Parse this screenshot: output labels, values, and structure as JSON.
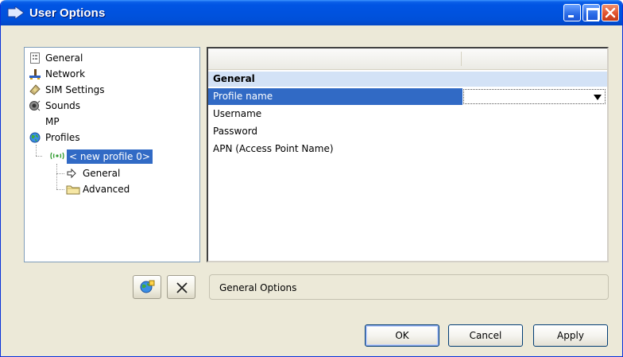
{
  "window": {
    "title": "User Options"
  },
  "tree": {
    "items": [
      {
        "label": "General",
        "icon": "document-list-icon"
      },
      {
        "label": "Network",
        "icon": "network-icon"
      },
      {
        "label": "SIM Settings",
        "icon": "sim-card-icon"
      },
      {
        "label": "Sounds",
        "icon": "speaker-icon"
      },
      {
        "label": "MP",
        "icon": ""
      },
      {
        "label": "Profiles",
        "icon": "globe-icon"
      }
    ],
    "profile": {
      "label": "< new profile 0>",
      "icon": "antenna-icon"
    },
    "profile_children": [
      {
        "label": "General",
        "icon": "arrow-right-icon"
      },
      {
        "label": "Advanced",
        "icon": "folder-icon"
      }
    ]
  },
  "grid": {
    "section": "General",
    "rows": [
      {
        "name": "Profile name",
        "value": ""
      },
      {
        "name": "Username",
        "value": ""
      },
      {
        "name": "Password",
        "value": ""
      },
      {
        "name": "APN (Access Point Name)",
        "value": ""
      }
    ]
  },
  "status": {
    "text": "General Options"
  },
  "buttons": {
    "ok": "OK",
    "cancel": "Cancel",
    "apply": "Apply"
  },
  "colors": {
    "titlebar": "#0054e3",
    "selection": "#316ac5",
    "section_bg": "#d3e2f6",
    "window_bg": "#ece9d8"
  }
}
